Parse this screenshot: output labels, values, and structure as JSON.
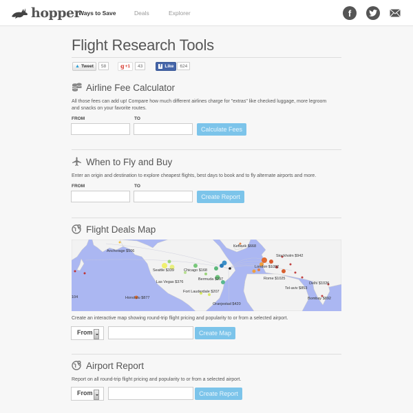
{
  "header": {
    "logo_text": "hopper",
    "nav": [
      {
        "label": "Ways to Save",
        "active": true
      },
      {
        "label": "Deals",
        "active": false
      },
      {
        "label": "Explorer",
        "active": false
      }
    ],
    "social": {
      "facebook_glyph": "f",
      "twitter_glyph": "t"
    }
  },
  "page_title": "Flight Research Tools",
  "share": {
    "tweet_label": "Tweet",
    "tweet_count": "58",
    "gplus_label": "+1",
    "gplus_count": "43",
    "like_label": "Like",
    "like_count": "624"
  },
  "sections": {
    "fee_calculator": {
      "icon": "coins-icon",
      "title": "Airline Fee Calculator",
      "description": "All those fees can add up! Compare how much different airlines charge for \"extras\" like checked luggage, more legroom and snacks on your favorite routes.",
      "from_label": "FROM",
      "to_label": "TO",
      "from_value": "",
      "to_value": "",
      "button_label": "Calculate Fees"
    },
    "when_to_fly": {
      "icon": "airplane-icon",
      "title": "When to Fly and Buy",
      "description": "Enter an origin and destination to explore cheapest flights, best days to book and to fly alternate airports and more.",
      "from_label": "FROM",
      "to_label": "TO",
      "from_value": "",
      "to_value": "",
      "button_label": "Create Report"
    },
    "deals_map": {
      "icon": "globe-pin-icon",
      "title": "Flight Deals Map",
      "description": "Create an interactive map showing round-trip flight pricing and popularity to or from a selected airport.",
      "select_value": "From",
      "airport_value": "",
      "button_label": "Create Map",
      "map_labels": [
        {
          "text": "Anchorage $506"
        },
        {
          "text": "Keflavik $668"
        },
        {
          "text": "Stockholm $942"
        },
        {
          "text": "London $1092"
        },
        {
          "text": "Seattle $339"
        },
        {
          "text": "Chicago $168"
        },
        {
          "text": "Las Vegas $376"
        },
        {
          "text": "Bermuda $297"
        },
        {
          "text": "Rome $1025"
        },
        {
          "text": "Honolulu $877"
        },
        {
          "text": "Fort Lauderdale $207"
        },
        {
          "text": "Tel-aviv $853"
        },
        {
          "text": "Delhi $1026"
        },
        {
          "text": "Oranjestad $420"
        },
        {
          "text": "Bombay $892"
        },
        {
          "text": "104"
        }
      ]
    },
    "airport_report": {
      "icon": "globe-pin-icon",
      "title": "Airport Report",
      "description": "Report on all round-trip flight pricing and popularity to or from a selected airport.",
      "select_value": "From",
      "airport_value": "",
      "button_label": "Create Report"
    }
  }
}
